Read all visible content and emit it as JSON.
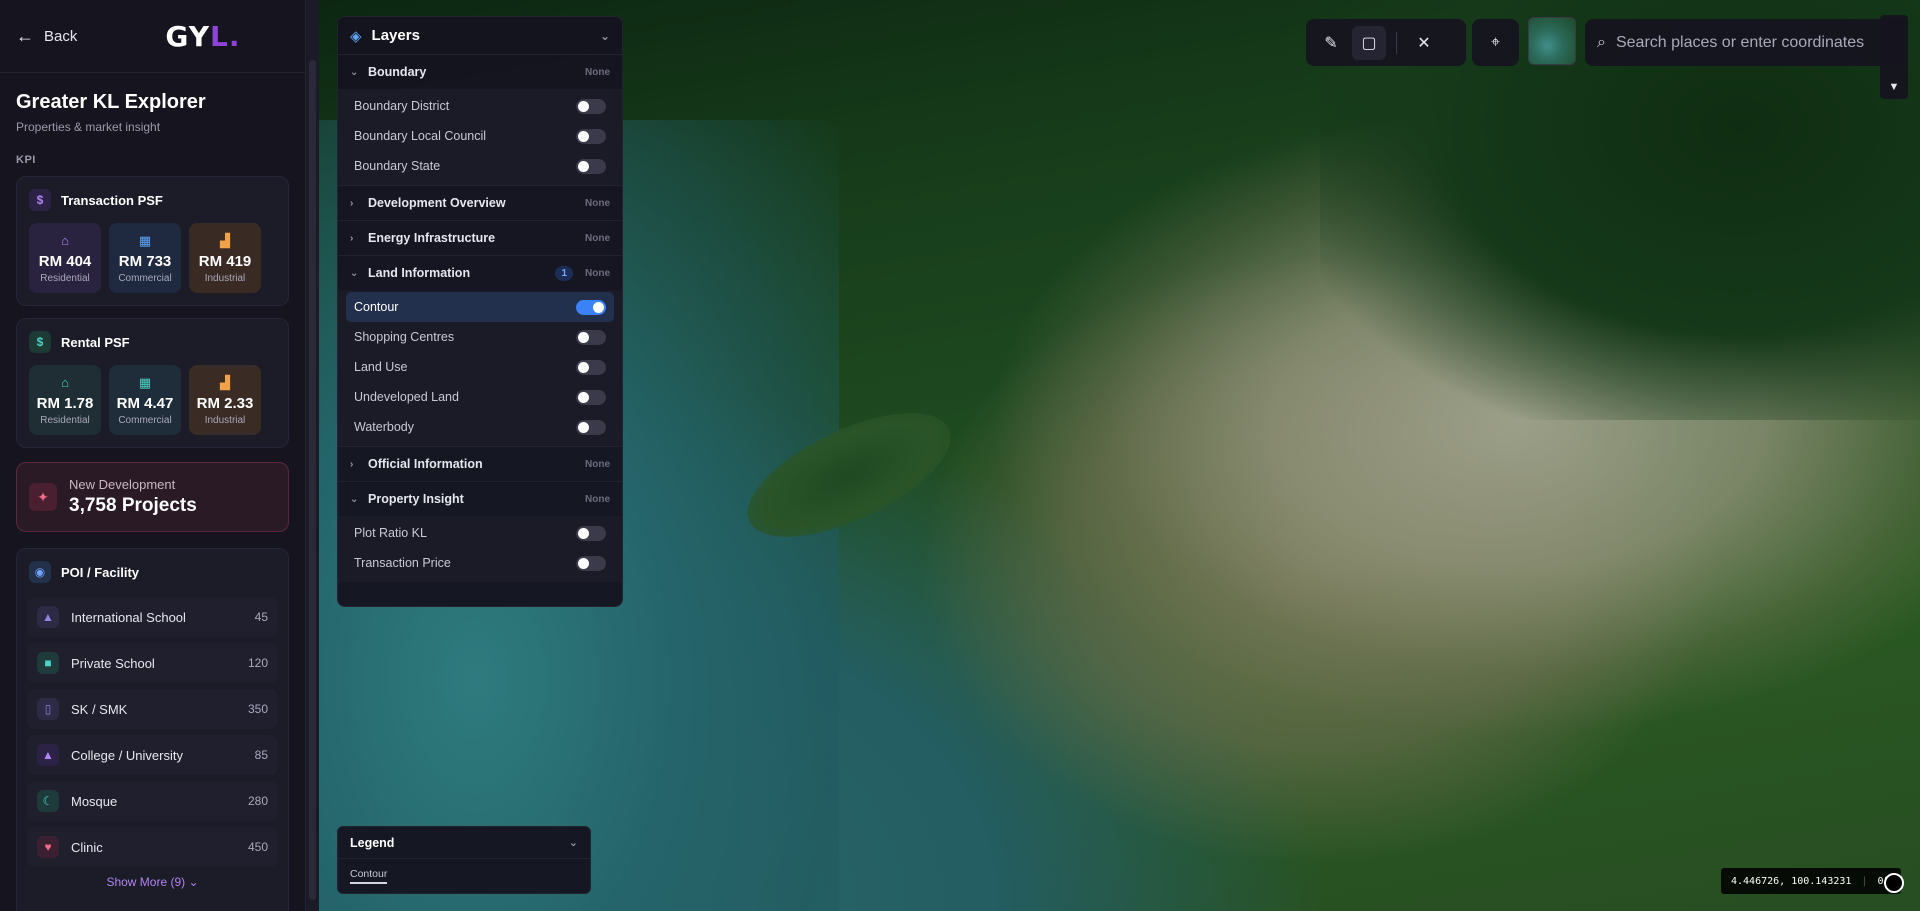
{
  "sidebar": {
    "back_label": "Back",
    "logo": {
      "main": "GYL",
      "text_prefix": "GY",
      "text_accent": "L."
    },
    "title": "Greater KL Explorer",
    "subtitle": "Properties & market insight",
    "kpi_label": "KPI",
    "transaction": {
      "title": "Transaction PSF",
      "icon": "dollar-icon",
      "tiles": [
        {
          "value": "RM 404",
          "label": "Residential",
          "icon": "home-icon"
        },
        {
          "value": "RM 733",
          "label": "Commercial",
          "icon": "building-icon"
        },
        {
          "value": "RM 419",
          "label": "Industrial",
          "icon": "factory-icon"
        }
      ]
    },
    "rental": {
      "title": "Rental PSF",
      "icon": "dollar-icon",
      "tiles": [
        {
          "value": "RM 1.78",
          "label": "Residential",
          "icon": "home-icon"
        },
        {
          "value": "RM 4.47",
          "label": "Commercial",
          "icon": "building-icon"
        },
        {
          "value": "RM 2.33",
          "label": "Industrial",
          "icon": "factory-icon"
        }
      ]
    },
    "new_development": {
      "label": "New Development",
      "value": "3,758 Projects",
      "icon": "sparkle-icon"
    },
    "poi": {
      "title": "POI / Facility",
      "icon": "pin-icon",
      "items": [
        {
          "name": "International School",
          "count": "45",
          "icon": "graduation-cap-icon"
        },
        {
          "name": "Private School",
          "count": "120",
          "icon": "school-icon"
        },
        {
          "name": "SK / SMK",
          "count": "350",
          "icon": "book-icon"
        },
        {
          "name": "College / University",
          "count": "85",
          "icon": "graduation-cap-icon"
        },
        {
          "name": "Mosque",
          "count": "280",
          "icon": "crescent-icon"
        },
        {
          "name": "Clinic",
          "count": "450",
          "icon": "stethoscope-icon"
        }
      ],
      "show_more": "Show More (9)"
    }
  },
  "layers": {
    "title": "Layers",
    "groups": [
      {
        "name": "Boundary",
        "expanded": true,
        "status": "None",
        "items": [
          {
            "name": "Boundary District",
            "on": false
          },
          {
            "name": "Boundary Local Council",
            "on": false
          },
          {
            "name": "Boundary State",
            "on": false
          }
        ]
      },
      {
        "name": "Development Overview",
        "expanded": false,
        "status": "None"
      },
      {
        "name": "Energy Infrastructure",
        "expanded": false,
        "status": "None"
      },
      {
        "name": "Land Information",
        "expanded": true,
        "status": "None",
        "badge": "1",
        "items": [
          {
            "name": "Contour",
            "on": true
          },
          {
            "name": "Shopping Centres",
            "on": false
          },
          {
            "name": "Land Use",
            "on": false
          },
          {
            "name": "Undeveloped Land",
            "on": false
          },
          {
            "name": "Waterbody",
            "on": false
          }
        ]
      },
      {
        "name": "Official Information",
        "expanded": false,
        "status": "None"
      },
      {
        "name": "Property Insight",
        "expanded": true,
        "status": "None",
        "items": [
          {
            "name": "Plot Ratio KL",
            "on": false
          },
          {
            "name": "Transaction Price",
            "on": false
          }
        ]
      }
    ]
  },
  "legend": {
    "title": "Legend",
    "item": "Contour"
  },
  "toolbar": {
    "search_placeholder": "Search places or enter coordinates",
    "tools": [
      "ruler-icon",
      "select-area-icon",
      "close-icon"
    ],
    "locate": "crosshair-icon",
    "basemap": "basemap-thumbnail"
  },
  "coords": {
    "text": "4.446726, 100.143231",
    "extra": "0°"
  }
}
